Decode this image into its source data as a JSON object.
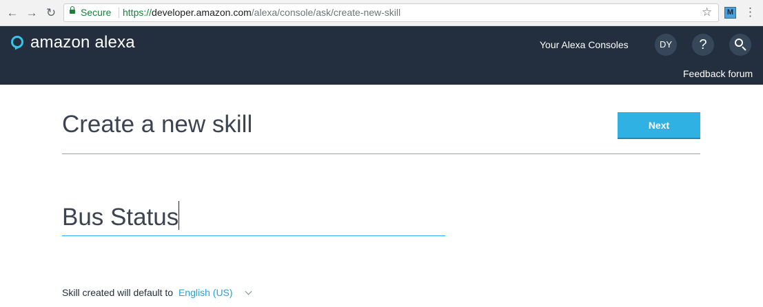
{
  "browser": {
    "secure_label": "Secure",
    "url_scheme": "https://",
    "url_host": "developer.amazon.com",
    "url_path": "/alexa/console/ask/create-new-skill",
    "extension_label": "M"
  },
  "header": {
    "logo_text": "amazon alexa",
    "consoles_label": "Your Alexa Consoles",
    "avatar_initials": "DY",
    "help_label": "?",
    "feedback_label": "Feedback forum"
  },
  "main": {
    "title": "Create a new skill",
    "next_label": "Next",
    "skill_name_value": "Bus Status",
    "default_prefix": "Skill created will default to",
    "default_language": "English (US)"
  },
  "colors": {
    "header_bg": "#232f3e",
    "accent": "#2fb1e4",
    "link": "#1ea4d9",
    "secure_green": "#188038"
  }
}
